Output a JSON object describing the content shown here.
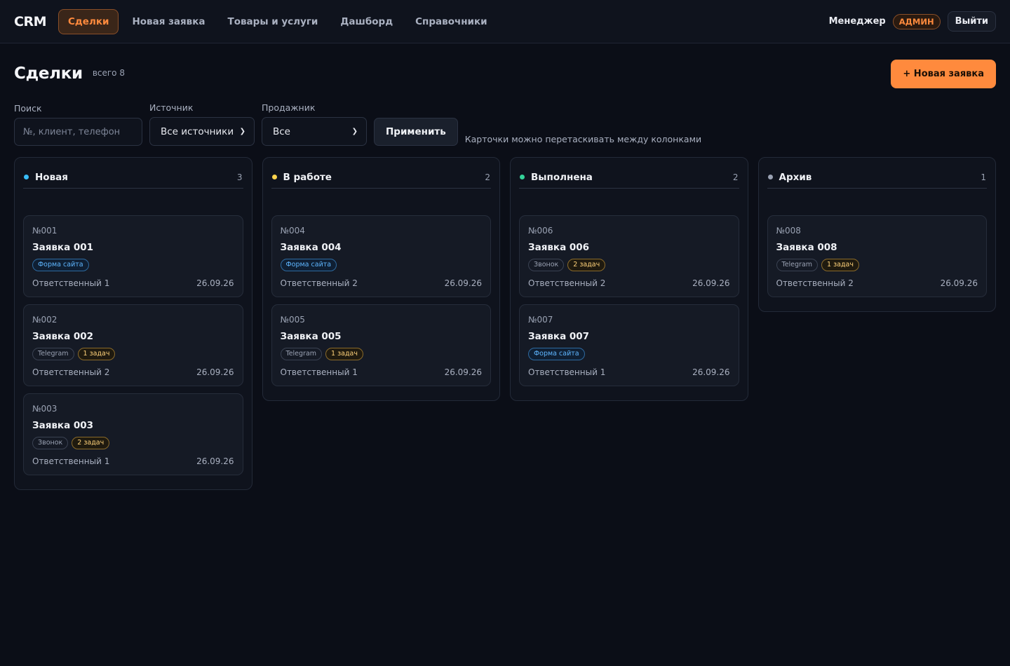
{
  "header": {
    "logo": "CRM",
    "nav": [
      "Сделки",
      "Новая заявка",
      "Товары и услуги",
      "Дашборд",
      "Справочники"
    ],
    "active_nav": 0,
    "user": "Менеджер",
    "role": "АДМИН",
    "logout": "Выйти"
  },
  "page": {
    "title": "Сделки",
    "count": "всего 8",
    "new_button": "+ Новая заявка"
  },
  "filters": {
    "search_label": "Поиск",
    "search_placeholder": "№, клиент, телефон",
    "source_label": "Источник",
    "source_value": "Все источники",
    "seller_label": "Продажник",
    "seller_value": "Все",
    "apply": "Применить",
    "hint": "Карточки можно перетаскивать между колонками"
  },
  "colors": {
    "accent": "#ff8a3d",
    "dot_new": "#38bdf8",
    "dot_work": "#fcd34d",
    "dot_done": "#34d399",
    "dot_archive": "#9aa2b3"
  },
  "columns": [
    {
      "title": "Новая",
      "count": "3",
      "dot": "#38bdf8",
      "cards": [
        {
          "num": "№001",
          "title": "Заявка 001",
          "tags": [
            {
              "text": "Форма сайта",
              "kind": "blue"
            }
          ],
          "owner": "Ответственный 1",
          "date": "26.09.26"
        },
        {
          "num": "№002",
          "title": "Заявка 002",
          "tags": [
            {
              "text": "Telegram",
              "kind": "grey"
            },
            {
              "text": "1 задач",
              "kind": "yellow"
            }
          ],
          "owner": "Ответственный 2",
          "date": "26.09.26"
        },
        {
          "num": "№003",
          "title": "Заявка 003",
          "tags": [
            {
              "text": "Звонок",
              "kind": "grey"
            },
            {
              "text": "2 задач",
              "kind": "yellow"
            }
          ],
          "owner": "Ответственный 1",
          "date": "26.09.26"
        }
      ]
    },
    {
      "title": "В работе",
      "count": "2",
      "dot": "#fcd34d",
      "cards": [
        {
          "num": "№004",
          "title": "Заявка 004",
          "tags": [
            {
              "text": "Форма сайта",
              "kind": "blue"
            }
          ],
          "owner": "Ответственный 2",
          "date": "26.09.26"
        },
        {
          "num": "№005",
          "title": "Заявка 005",
          "tags": [
            {
              "text": "Telegram",
              "kind": "grey"
            },
            {
              "text": "1 задач",
              "kind": "yellow"
            }
          ],
          "owner": "Ответственный 1",
          "date": "26.09.26"
        }
      ]
    },
    {
      "title": "Выполнена",
      "count": "2",
      "dot": "#34d399",
      "cards": [
        {
          "num": "№006",
          "title": "Заявка 006",
          "tags": [
            {
              "text": "Звонок",
              "kind": "grey"
            },
            {
              "text": "2 задач",
              "kind": "yellow"
            }
          ],
          "owner": "Ответственный 2",
          "date": "26.09.26"
        },
        {
          "num": "№007",
          "title": "Заявка 007",
          "tags": [
            {
              "text": "Форма сайта",
              "kind": "blue"
            }
          ],
          "owner": "Ответственный 1",
          "date": "26.09.26"
        }
      ]
    },
    {
      "title": "Архив",
      "count": "1",
      "dot": "#9aa2b3",
      "cards": [
        {
          "num": "№008",
          "title": "Заявка 008",
          "tags": [
            {
              "text": "Telegram",
              "kind": "grey"
            },
            {
              "text": "1 задач",
              "kind": "yellow"
            }
          ],
          "owner": "Ответственный 2",
          "date": "26.09.26"
        }
      ]
    }
  ]
}
